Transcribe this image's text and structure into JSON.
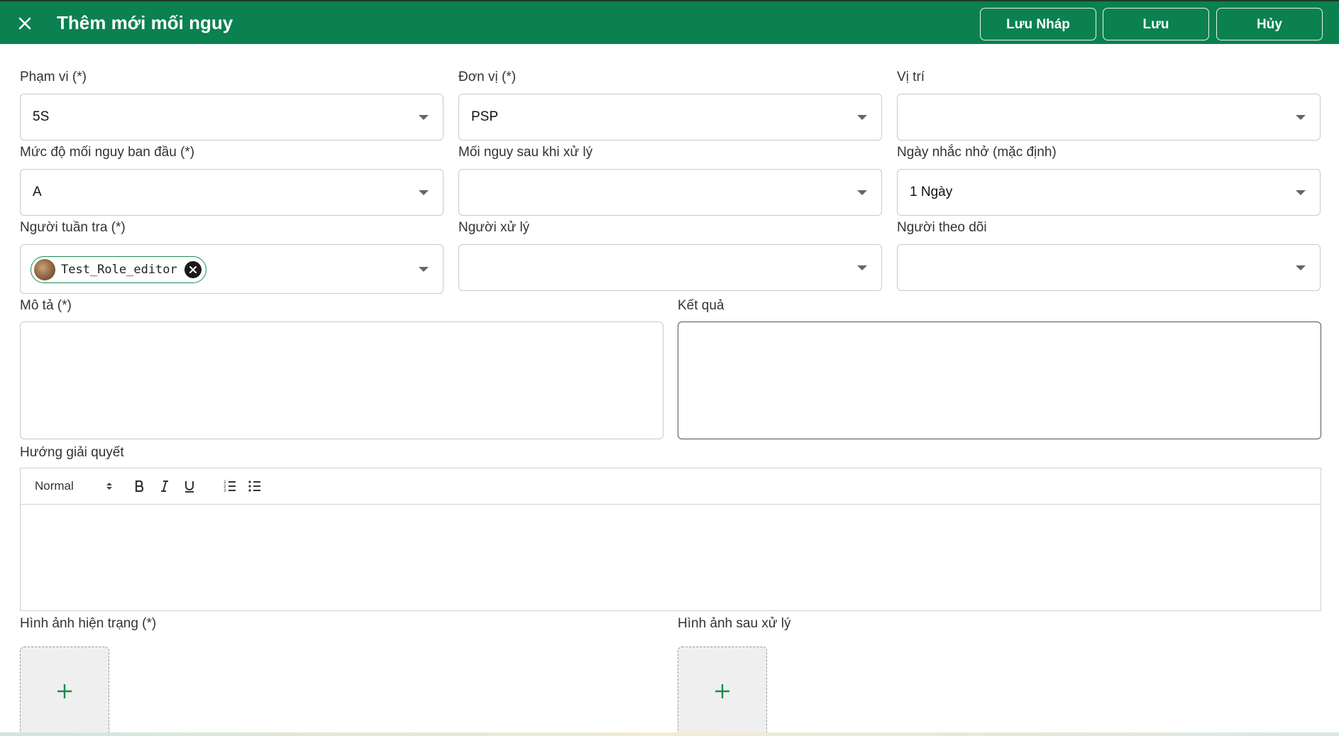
{
  "header": {
    "title": "Thêm mới mối nguy",
    "buttons": {
      "save_draft": "Lưu Nháp",
      "save": "Lưu",
      "cancel": "Hủy"
    }
  },
  "form": {
    "scope": {
      "label": "Phạm vi (*)",
      "value": "5S"
    },
    "unit": {
      "label": "Đơn vị (*)",
      "value": "PSP"
    },
    "location": {
      "label": "Vị trí",
      "value": ""
    },
    "initial_level": {
      "label": "Mức độ mối nguy ban đầu (*)",
      "value": "A"
    },
    "after_level": {
      "label": "Mối nguy sau khi xử lý",
      "value": ""
    },
    "reminder": {
      "label": "Ngày nhắc nhở (mặc định)",
      "value": "1 Ngày"
    },
    "patroller": {
      "label": "Người tuần tra (*)",
      "chip": "Test_Role_editor"
    },
    "handler": {
      "label": "Người xử lý",
      "value": ""
    },
    "follower": {
      "label": "Người theo dõi",
      "value": ""
    },
    "description": {
      "label": "Mô tả (*)",
      "value": ""
    },
    "result": {
      "label": "Kết quả",
      "value": ""
    },
    "solution": {
      "label": "Hướng giải quyết",
      "format": "Normal",
      "tools": [
        "bold-icon",
        "italic-icon",
        "underline-icon",
        "ordered-list-icon",
        "bullet-list-icon"
      ]
    },
    "image_current": {
      "label": "Hình ảnh hiện trạng (*)"
    },
    "image_after": {
      "label": "Hình ảnh sau xử lý"
    }
  },
  "colors": {
    "header_bg": "#0a814e",
    "accent": "#1b8a4f",
    "upload_bg": "#efefef"
  }
}
